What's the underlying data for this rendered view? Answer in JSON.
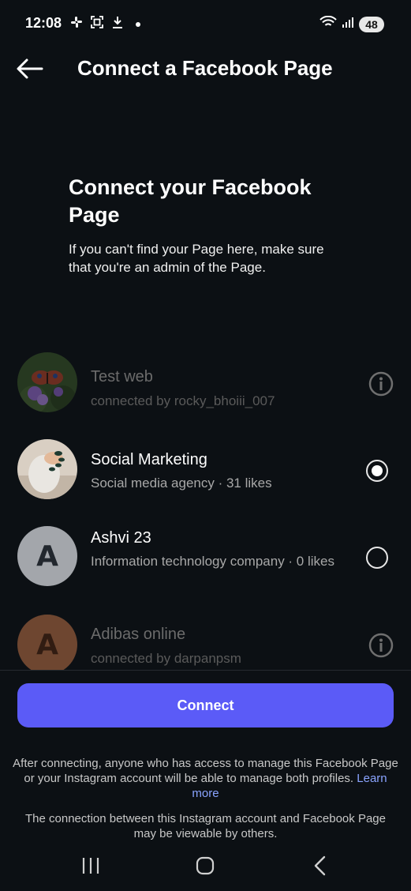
{
  "status_bar": {
    "time": "12:08",
    "battery": "48",
    "icons": [
      "slack-icon",
      "screenshot-icon",
      "download-icon",
      "dot-icon",
      "wifi-icon",
      "signal-icon"
    ]
  },
  "header": {
    "title": "Connect a Facebook Page",
    "back_icon": "back-arrow-icon"
  },
  "intro": {
    "title": "Connect your Facebook Page",
    "text": "If you can't find your Page here, make sure that you're an admin of the Page."
  },
  "pages": [
    {
      "name": "Test web",
      "subtitle": "connected by rocky_bhoiii_007",
      "state": "disabled",
      "control": "info-icon"
    },
    {
      "name": "Social Marketing",
      "subtitle": "Social media agency · 31 likes",
      "state": "selected",
      "control": "radio"
    },
    {
      "name": "Ashvi 23",
      "subtitle": "Information technology company · 0 likes",
      "state": "unselected",
      "control": "radio",
      "avatar_letter": "A"
    },
    {
      "name": "Adibas online",
      "subtitle": "connected by darpanpsm",
      "state": "disabled",
      "control": "info-icon",
      "avatar_letter": "A"
    }
  ],
  "connect_button": "Connect",
  "footer": {
    "notice": "After connecting, anyone who has access to manage this Facebook Page or your Instagram account will be able to manage both profiles.",
    "learn_more": "Learn more",
    "visibility": "The connection between this Instagram account and Facebook Page may be viewable by others."
  },
  "nav": [
    "recent-apps-icon",
    "home-icon",
    "back-icon"
  ],
  "colors": {
    "background": "#0c1014",
    "accent": "#5b5bf7",
    "link": "#8aa4ff"
  }
}
